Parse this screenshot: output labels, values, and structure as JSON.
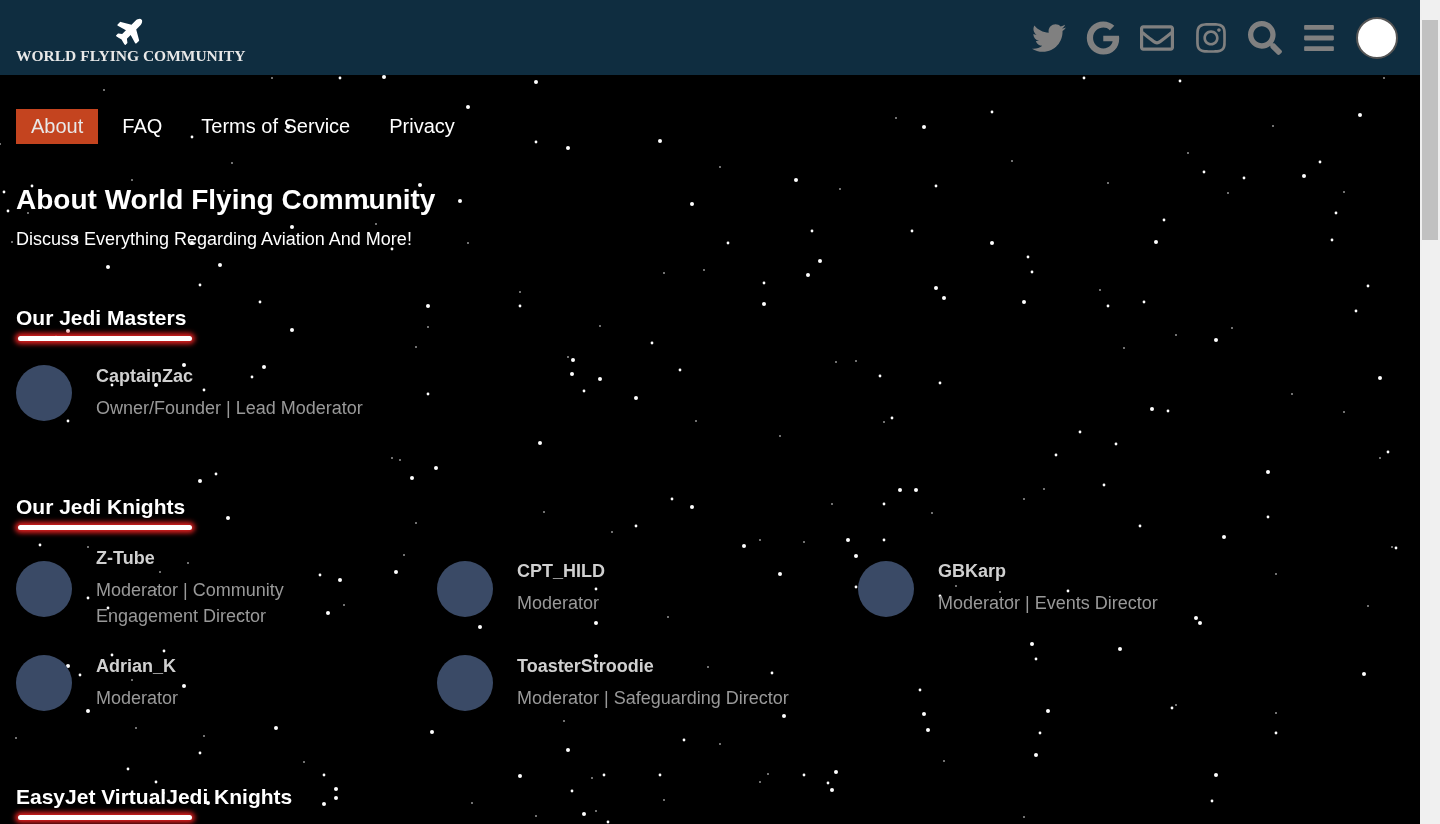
{
  "header": {
    "logo_text": "WORLD FLYING COMMUNITY"
  },
  "nav": [
    {
      "label": "About",
      "selected": true
    },
    {
      "label": "FAQ",
      "selected": false
    },
    {
      "label": "Terms of Service",
      "selected": false
    },
    {
      "label": "Privacy",
      "selected": false
    }
  ],
  "title": "About World Flying Community",
  "subtitle": "Discuss Everything Regarding Aviation And More!",
  "sections": [
    {
      "title": "Our Jedi Masters",
      "members": [
        {
          "name": "CaptainZac",
          "role": "Owner/Founder | Lead Moderator"
        }
      ]
    },
    {
      "title": "Our Jedi Knights",
      "members": [
        {
          "name": "Z-Tube",
          "role": "Moderator | Community Engagement Director"
        },
        {
          "name": "CPT_HILD",
          "role": "Moderator"
        },
        {
          "name": "GBKarp",
          "role": "Moderator | Events Director"
        },
        {
          "name": "Adrian_K",
          "role": "Moderator"
        },
        {
          "name": "ToasterStroodie",
          "role": "Moderator | Safeguarding Director"
        }
      ]
    },
    {
      "title": "EasyJet VirtualJedi Knights"
    }
  ]
}
